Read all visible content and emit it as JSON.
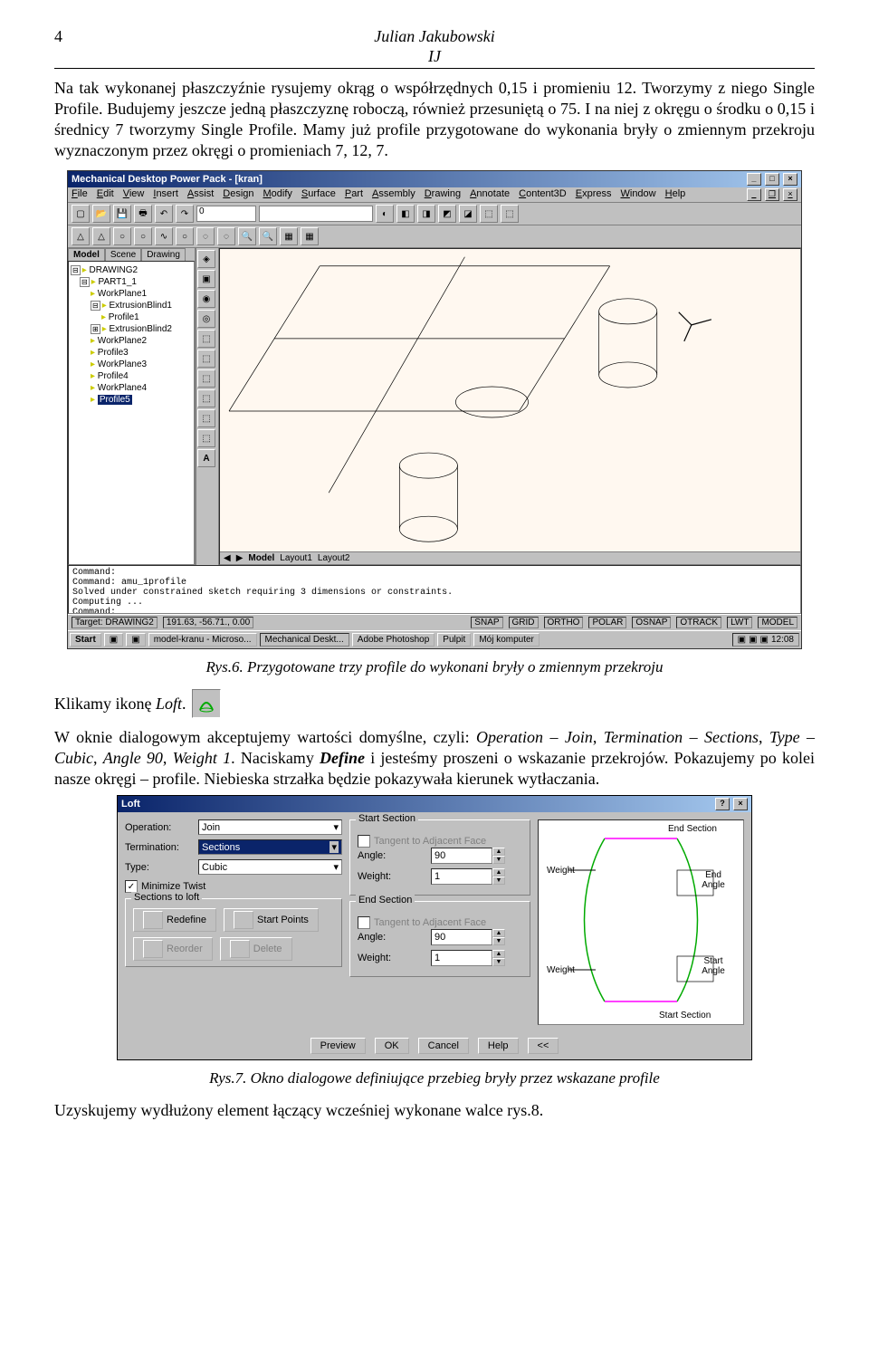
{
  "page": {
    "number": "4",
    "author": "Julian Jakubowski",
    "initials": "IJ"
  },
  "para1": "Na tak wykonanej płaszczyźnie rysujemy okrąg o współrzędnych 0,15 i promieniu 12. Tworzymy z niego Single Profile. Budujemy jeszcze jedną płaszczyznę roboczą, również przesuniętą o 75. I na niej z okręgu o środku o 0,15 i średnicy 7 tworzymy Single Profile. Mamy już profile przygotowane do wykonania bryły o zmiennym przekroju wyznaczonym przez okręgi o promieniach 7, 12, 7.",
  "caption1": "Rys.6. Przygotowane trzy profile do wykonani bryły o zmiennym przekroju",
  "loft_prefix": "Klikamy ikonę ",
  "loft_word": "Loft",
  "loft_suffix": ".",
  "para2a": "W oknie dialogowym akceptujemy wartości domyślne, czyli: ",
  "para2b": "Operation – Join",
  "para2c": ", ",
  "para2d": "Termination – Sections",
  "para2e": ", ",
  "para2f": "Type – Cubic",
  "para2g": ", ",
  "para2h": "Angle 90",
  "para2i": ", ",
  "para2j": "Weight 1",
  "para2k": ". Naciskamy ",
  "para2l": "Define",
  "para2m": " i jesteśmy proszeni o wskazanie przekrojów. Pokazujemy po kolei nasze okręgi – profile. Niebieska strzałka będzie pokazywała kierunek wytłaczania.",
  "caption2": "Rys.7. Okno dialogowe definiujące przebieg bryły przez wskazane profile",
  "last": "Uzyskujemy wydłużony element łączący wcześniej wykonane walce rys.8.",
  "app": {
    "title": "Mechanical Desktop Power Pack - [kran]",
    "menus": [
      "File",
      "Edit",
      "View",
      "Insert",
      "Assist",
      "Design",
      "Modify",
      "Surface",
      "Part",
      "Assembly",
      "Drawing",
      "Annotate",
      "Content3D",
      "Express",
      "Window",
      "Help"
    ],
    "layer": "0",
    "tabs": [
      "Model",
      "Scene",
      "Drawing"
    ],
    "tree": [
      {
        "t": "DRAWING2",
        "i": 0,
        "box": "⊟"
      },
      {
        "t": "PART1_1",
        "i": 1,
        "box": "⊟"
      },
      {
        "t": "WorkPlane1",
        "i": 2
      },
      {
        "t": "ExtrusionBlind1",
        "i": 2,
        "box": "⊟"
      },
      {
        "t": "Profile1",
        "i": 3
      },
      {
        "t": "ExtrusionBlind2",
        "i": 2,
        "box": "⊞"
      },
      {
        "t": "WorkPlane2",
        "i": 2
      },
      {
        "t": "Profile3",
        "i": 2
      },
      {
        "t": "WorkPlane3",
        "i": 2
      },
      {
        "t": "Profile4",
        "i": 2
      },
      {
        "t": "WorkPlane4",
        "i": 2
      },
      {
        "t": "Profile5",
        "i": 2,
        "sel": true
      }
    ],
    "viewtabs": [
      "Model",
      "Layout1",
      "Layout2"
    ],
    "cmd": "Command:\nCommand: amu_1profile\nSolved under constrained sketch requiring 3 dimensions or constraints.\nComputing ...\nCommand:",
    "target": "Target: DRAWING2",
    "coords": "191.63, -56.71., 0.00",
    "modes": [
      "SNAP",
      "GRID",
      "ORTHO",
      "POLAR",
      "OSNAP",
      "OTRACK",
      "LWT",
      "MODEL"
    ],
    "taskbar": {
      "start": "Start",
      "items": [
        "model-kranu - Microso...",
        "Mechanical Deskt...",
        "Adobe Photoshop",
        "Pulpit",
        "Mój komputer"
      ],
      "clock": "12:08"
    }
  },
  "dlg": {
    "title": "Loft",
    "operation_lbl": "Operation:",
    "operation_val": "Join",
    "termination_lbl": "Termination:",
    "termination_val": "Sections",
    "type_lbl": "Type:",
    "type_val": "Cubic",
    "minimize": "Minimize Twist",
    "sections_grp": "Sections to loft",
    "redefine": "Redefine",
    "startpts": "Start Points",
    "reorder": "Reorder",
    "delete": "Delete",
    "start_grp": "Start Section",
    "end_grp": "End Section",
    "tangent": "Tangent to Adjacent Face",
    "angle_lbl": "Angle:",
    "angle_val": "90",
    "weight_lbl": "Weight:",
    "weight_val": "1",
    "preview": "Preview",
    "ok": "OK",
    "cancel": "Cancel",
    "help": "Help",
    "collapse": "<<",
    "diag": {
      "end_section": "End Section",
      "start_section": "Start Section",
      "weight": "Weight",
      "end_angle": "End\nAngle",
      "start_angle": "Start\nAngle"
    }
  }
}
